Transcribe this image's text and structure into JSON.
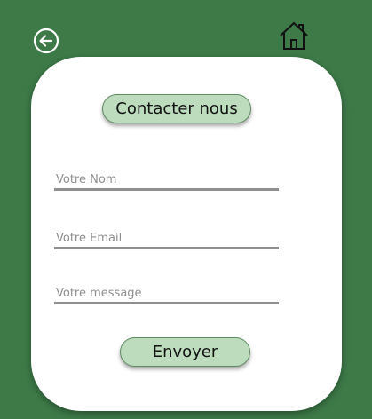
{
  "header": {
    "back_icon": "back-circle-arrow-icon",
    "home_icon": "home-icon"
  },
  "form": {
    "title": "Contacter nous",
    "name_placeholder": "Votre Nom",
    "email_placeholder": "Votre Email",
    "message_placeholder": "Votre message",
    "submit_label": "Envoyer"
  },
  "colors": {
    "background": "#3d7a48",
    "card": "#ffffff",
    "pill": "#bcdcbd",
    "underline": "#8f8f8f"
  }
}
